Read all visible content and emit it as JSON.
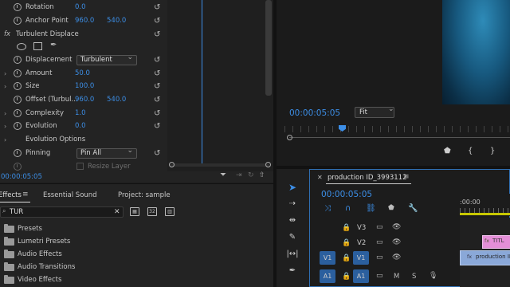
{
  "effect_controls": {
    "rotation": {
      "label": "Rotation",
      "value": "0.0"
    },
    "anchor_point": {
      "label": "Anchor Point",
      "x": "960.0",
      "y": "540.0"
    },
    "fx_badge": "fx",
    "effect_name": "Turbulent Displace",
    "displacement": {
      "label": "Displacement",
      "value": "Turbulent"
    },
    "amount": {
      "label": "Amount",
      "value": "50.0"
    },
    "size": {
      "label": "Size",
      "value": "100.0"
    },
    "offset": {
      "label": "Offset (Turbul...",
      "x": "960.0",
      "y": "540.0"
    },
    "complexity": {
      "label": "Complexity",
      "value": "1.0"
    },
    "evolution": {
      "label": "Evolution",
      "value": "0.0"
    },
    "evolution_options": "Evolution Options",
    "pinning": {
      "label": "Pinning",
      "value": "Pin All"
    },
    "resize_layer": "Resize Layer",
    "timecode": "00:00:05:05"
  },
  "program_monitor": {
    "timecode": "00:00:05:05",
    "fit": "Fit"
  },
  "effects_panel": {
    "tabs": [
      "Effects",
      "Essential Sound",
      "Project: sample"
    ],
    "search_value": "TUR",
    "bins": [
      "Presets",
      "Lumetri Presets",
      "Audio Effects",
      "Audio Transitions",
      "Video Effects"
    ]
  },
  "timeline": {
    "sequence_name": "production ID_3993112",
    "timecode": "00:00:05:05",
    "ruler_label": ":00:00",
    "tracks": {
      "v3": "V3",
      "v2": "V2",
      "v1_src": "V1",
      "v1": "V1",
      "a1_src": "A1",
      "a1": "A1",
      "mute": "M",
      "solo": "S"
    },
    "clip_title": "TITL",
    "clip_video": "production ID"
  },
  "colors": {
    "accent_blue": "#3c8ee6",
    "clip_pink": "#e58fd8",
    "clip_blue": "#8aa8d8"
  }
}
